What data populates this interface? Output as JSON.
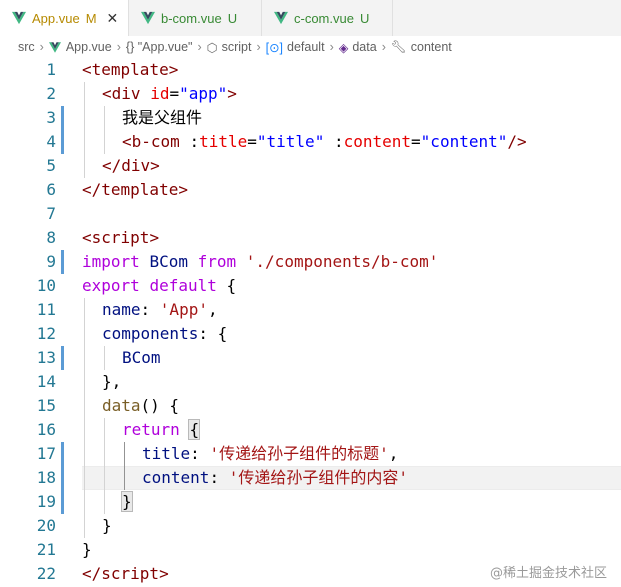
{
  "tabs": [
    {
      "name": "App.vue",
      "badge": "M",
      "active": true
    },
    {
      "name": "b-com.vue",
      "badge": "U",
      "active": false
    },
    {
      "name": "c-com.vue",
      "badge": "U",
      "active": false
    }
  ],
  "breadcrumb": {
    "src": "src",
    "file": "App.vue",
    "obj": "{} \"App.vue\"",
    "script": "script",
    "default": "default",
    "data": "data",
    "content": "content"
  },
  "editor": {
    "line_numbers": [
      "1",
      "2",
      "3",
      "4",
      "5",
      "6",
      "7",
      "8",
      "9",
      "10",
      "11",
      "12",
      "13",
      "14",
      "15",
      "16",
      "17",
      "18",
      "19",
      "20",
      "21",
      "22"
    ],
    "lines": {
      "l1": {
        "t1": "<",
        "t2": "template",
        "t3": ">"
      },
      "l2": {
        "t1": "<",
        "t2": "div",
        "t3": " ",
        "t4": "id",
        "t5": "=",
        "t6": "\"app\"",
        "t7": ">"
      },
      "l3": {
        "t1": "我是父组件"
      },
      "l4": {
        "t1": "<",
        "t2": "b-com",
        "t3": " :",
        "t4": "title",
        "t5": "=",
        "t6": "\"title\"",
        "t7": " :",
        "t8": "content",
        "t9": "=",
        "t10": "\"content\"",
        "t11": "/>"
      },
      "l5": {
        "t1": "</",
        "t2": "div",
        "t3": ">"
      },
      "l6": {
        "t1": "</",
        "t2": "template",
        "t3": ">"
      },
      "l8": {
        "t1": "<",
        "t2": "script",
        "t3": ">"
      },
      "l9": {
        "t1": "import",
        "t2": " ",
        "t3": "BCom",
        "t4": " ",
        "t5": "from",
        "t6": " ",
        "t7": "'./components/b-com'"
      },
      "l10": {
        "t1": "export",
        "t2": " ",
        "t3": "default",
        "t4": " {"
      },
      "l11": {
        "t1": "name",
        "t2": ": ",
        "t3": "'App'",
        "t4": ","
      },
      "l12": {
        "t1": "components",
        "t2": ": {"
      },
      "l13": {
        "t1": "BCom"
      },
      "l14": {
        "t1": "},"
      },
      "l15": {
        "t1": "data",
        "t2": "() {"
      },
      "l16": {
        "t1": "return",
        "t2": " ",
        "t3": "{"
      },
      "l17": {
        "t1": "title",
        "t2": ": ",
        "t3": "'传递给孙子组件的标题'",
        "t4": ","
      },
      "l18": {
        "t1": "content",
        "t2": ": ",
        "t3": "'传递给孙子组件的内容'"
      },
      "l19": {
        "t1": "}"
      },
      "l20": {
        "t1": "}"
      },
      "l21": {
        "t1": "}"
      },
      "l22": {
        "t1": "</",
        "t2": "script",
        "t3": ">"
      }
    }
  },
  "watermark": "@稀土掘金技术社区",
  "colors": {
    "line_number": "#237893",
    "tag": "#800000",
    "attribute": "#e50000",
    "html_string": "#0000ff",
    "keyword": "#0000ff",
    "control_keyword": "#af00db",
    "variable": "#001080",
    "function": "#795e26",
    "js_string": "#a31515",
    "type": "#267f99",
    "git_modified_bar": "#5b9bd5",
    "vue_logo": "#41b883"
  },
  "icons": [
    "vue-logo-icon",
    "close-icon",
    "chevron-right-icon",
    "braces-icon",
    "symbol-module-icon",
    "symbol-variable-icon",
    "symbol-method-icon",
    "wrench-icon"
  ]
}
